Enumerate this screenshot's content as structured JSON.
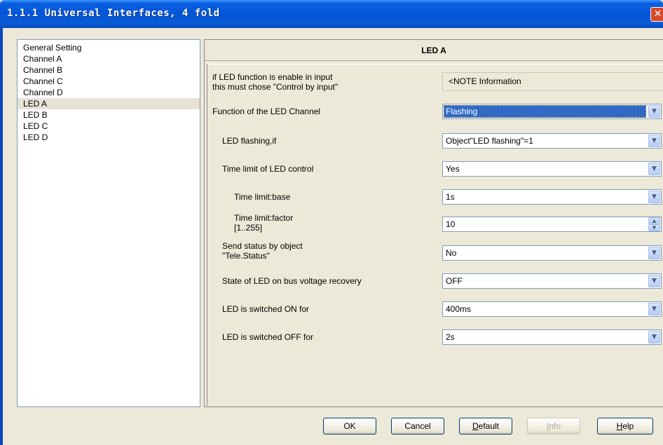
{
  "window": {
    "title": "1.1.1 Universal Interfaces, 4 fold",
    "close_label": "✕"
  },
  "tree": {
    "items": [
      {
        "label": "General Setting"
      },
      {
        "label": "Channel A"
      },
      {
        "label": "Channel B"
      },
      {
        "label": "Channel C"
      },
      {
        "label": "Channel D"
      },
      {
        "label": "LED A",
        "selected": true
      },
      {
        "label": "LED B"
      },
      {
        "label": "LED C"
      },
      {
        "label": "LED D"
      }
    ]
  },
  "panel": {
    "title": "LED A",
    "note_label_line1": "if LED function is enable in input",
    "note_label_line2": "this must chose \"Control by input\"",
    "note_value": "<NOTE Information",
    "rows": [
      {
        "label": "Function of the LED Channel",
        "value": "Flashing"
      },
      {
        "label": "LED flashing,if",
        "value": "Object\"LED flashing\"=1"
      },
      {
        "label": "Time limit of LED control",
        "value": "Yes"
      },
      {
        "label": "Time limit:base",
        "value": "1s"
      },
      {
        "label_line1": "Time limit:factor",
        "label_line2": "[1..255]",
        "value": "10"
      },
      {
        "label_line1": "Send status by object",
        "label_line2": "\"Tele.Status\"",
        "value": "No"
      },
      {
        "label": "State of LED on bus voltage recovery",
        "value": "OFF"
      },
      {
        "label": "LED is switched ON for",
        "value": "400ms"
      },
      {
        "label": "LED is switched OFF for",
        "value": "2s"
      }
    ]
  },
  "buttons": {
    "ok": "OK",
    "cancel": "Cancel",
    "default_underlined": "D",
    "default_rest": "efault",
    "info_underlined": "I",
    "info_rest": "nfo",
    "help_underlined": "H",
    "help_rest": "elp"
  }
}
